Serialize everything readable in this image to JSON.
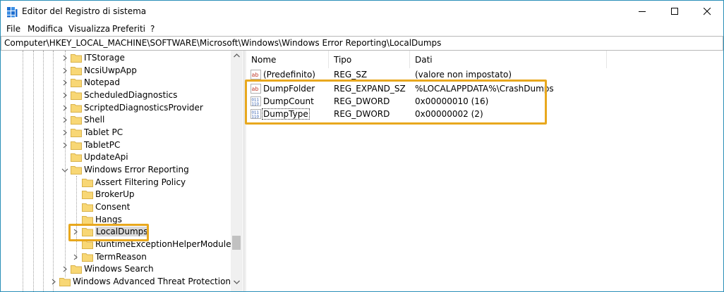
{
  "window": {
    "title": "Editor del Registro di sistema"
  },
  "menu": [
    "File",
    "Modifica",
    "Visualizza",
    "Preferiti",
    "?"
  ],
  "address": "Computer\\HKEY_LOCAL_MACHINE\\SOFTWARE\\Microsoft\\Windows\\Windows Error Reporting\\LocalDumps",
  "tree": {
    "items": [
      {
        "label": "ITStorage",
        "expander": "collapsed"
      },
      {
        "label": "NcsiUwpApp",
        "expander": "collapsed"
      },
      {
        "label": "Notepad",
        "expander": "collapsed"
      },
      {
        "label": "ScheduledDiagnostics",
        "expander": "collapsed"
      },
      {
        "label": "ScriptedDiagnosticsProvider",
        "expander": "collapsed"
      },
      {
        "label": "Shell",
        "expander": "collapsed"
      },
      {
        "label": "Tablet PC",
        "expander": "collapsed"
      },
      {
        "label": "TabletPC",
        "expander": "collapsed"
      },
      {
        "label": "UpdateApi",
        "expander": "collapsed"
      },
      {
        "label": "Windows Error Reporting",
        "expander": "expanded"
      },
      {
        "label": "Assert Filtering Policy",
        "expander": "none"
      },
      {
        "label": "BrokerUp",
        "expander": "none"
      },
      {
        "label": "Consent",
        "expander": "none"
      },
      {
        "label": "Hangs",
        "expander": "none"
      },
      {
        "label": "LocalDumps",
        "expander": "collapsed",
        "selected": true
      },
      {
        "label": "RuntimeExceptionHelperModules",
        "expander": "none"
      },
      {
        "label": "TermReason",
        "expander": "collapsed"
      },
      {
        "label": "Windows Search",
        "expander": "collapsed"
      },
      {
        "label": "Windows Advanced Threat Protection",
        "expander": "collapsed"
      }
    ]
  },
  "list": {
    "columns": [
      "Nome",
      "Tipo",
      "Dati"
    ],
    "rows": [
      {
        "icon": "string-value-icon",
        "name": "(Predefinito)",
        "type": "REG_SZ",
        "data": "(valore non impostato)"
      },
      {
        "icon": "string-value-icon",
        "name": "DumpFolder",
        "type": "REG_EXPAND_SZ",
        "data": "%LOCALAPPDATA%\\CrashDumps"
      },
      {
        "icon": "binary-value-icon",
        "name": "DumpCount",
        "type": "REG_DWORD",
        "data": "0x00000010 (16)"
      },
      {
        "icon": "binary-value-icon",
        "name": "DumpType",
        "type": "REG_DWORD",
        "data": "0x00000002 (2)"
      }
    ]
  },
  "colors": {
    "highlight": "#e8a81e",
    "folder": "#f8d775",
    "window_border": "#2a8fb8",
    "selection": "#cce8ff"
  }
}
